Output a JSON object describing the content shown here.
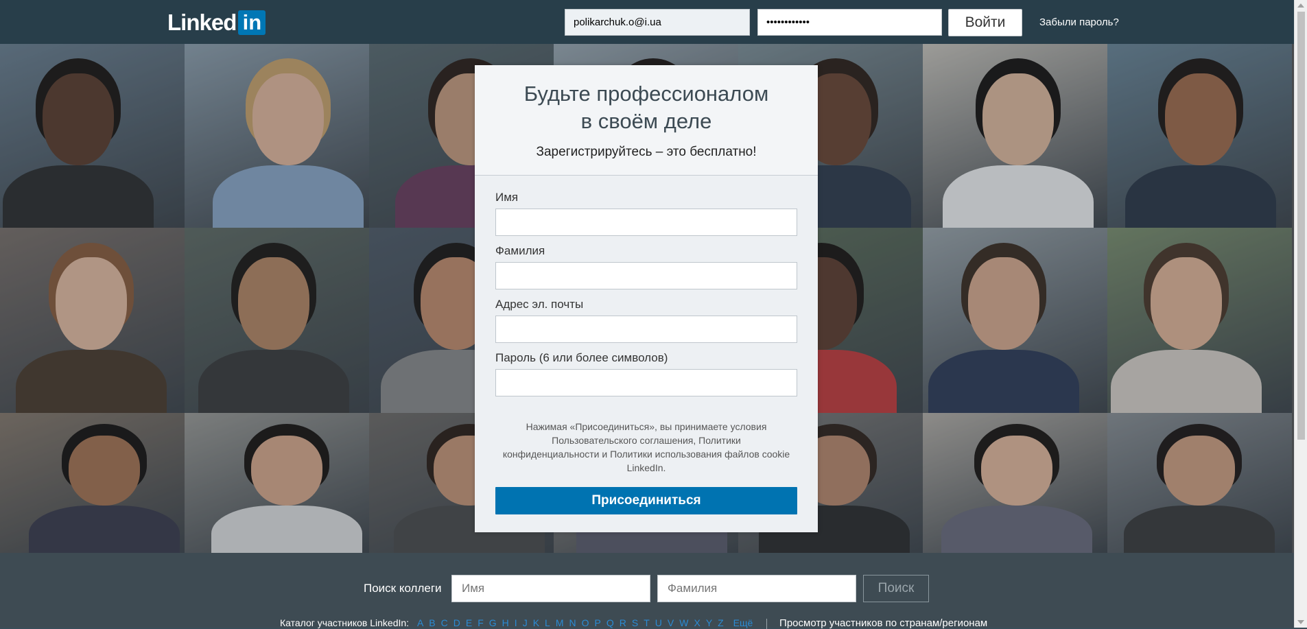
{
  "header": {
    "logo_text": "Linked",
    "logo_in": "in",
    "email_value": "polikarchuk.o@i.ua",
    "password_value": "••••••••••••",
    "login_button": "Войти",
    "forgot_password": "Забыли пароль?"
  },
  "signup": {
    "title": "Будьте профессионалом в своём деле",
    "subtitle": "Зарегистрируйтесь – это бесплатно!",
    "first_name_label": "Имя",
    "last_name_label": "Фамилия",
    "email_label": "Адрес эл. почты",
    "password_label": "Пароль (6 или более символов)",
    "terms": "Нажимая «Присоединиться», вы принимаете условия Пользовательского соглашения, Политики конфиденциальности и Политики использования файлов cookie LinkedIn.",
    "join_button": "Присоединиться"
  },
  "footer": {
    "search_label": "Поиск коллеги",
    "first_name_placeholder": "Имя",
    "last_name_placeholder": "Фамилия",
    "search_button": "Поиск",
    "directory_label": "Каталог участников LinkedIn:",
    "letters": [
      "A",
      "B",
      "C",
      "D",
      "E",
      "F",
      "G",
      "H",
      "I",
      "J",
      "K",
      "L",
      "M",
      "N",
      "O",
      "P",
      "Q",
      "R",
      "S",
      "T",
      "U",
      "V",
      "W",
      "X",
      "Y",
      "Z"
    ],
    "more": "Ещё",
    "country_link": "Просмотр участников по странам/регионам"
  },
  "colors": {
    "header_bg": "#283e4a",
    "brand_blue": "#0073b1",
    "footer_bg": "#3e4b53",
    "link_blue": "#2a8bd4"
  }
}
